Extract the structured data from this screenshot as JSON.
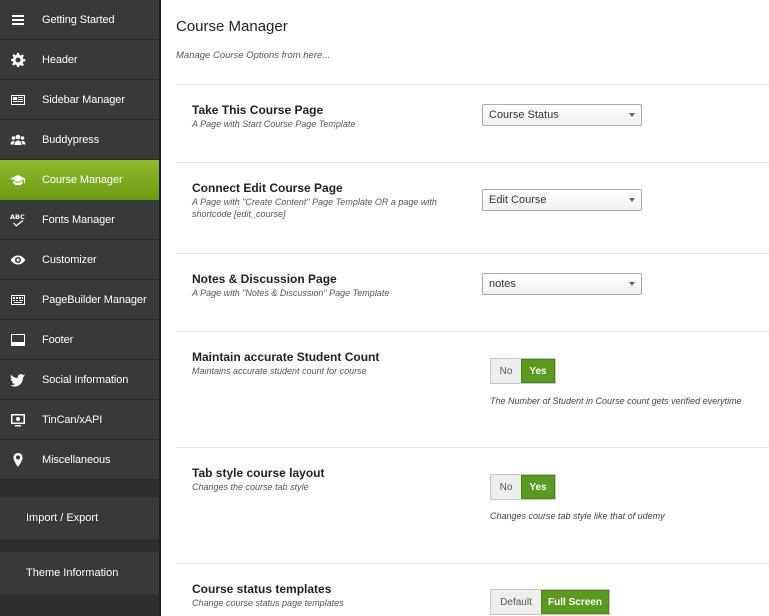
{
  "sidebar": {
    "items": [
      {
        "label": "Getting Started",
        "icon": "menu-icon"
      },
      {
        "label": "Header",
        "icon": "gear-icon"
      },
      {
        "label": "Sidebar Manager",
        "icon": "sidebar-icon"
      },
      {
        "label": "Buddypress",
        "icon": "users-icon"
      },
      {
        "label": "Course Manager",
        "icon": "graduation-cap-icon",
        "active": true
      },
      {
        "label": "Fonts Manager",
        "icon": "spellcheck-icon"
      },
      {
        "label": "Customizer",
        "icon": "eye-icon"
      },
      {
        "label": "PageBuilder Manager",
        "icon": "keyboard-icon"
      },
      {
        "label": "Footer",
        "icon": "footer-icon"
      },
      {
        "label": "Social Information",
        "icon": "twitter-icon"
      },
      {
        "label": "TinCan/xAPI",
        "icon": "monitor-icon"
      },
      {
        "label": "Miscellaneous",
        "icon": "map-pin-icon"
      }
    ],
    "extra": [
      {
        "label": "Import / Export"
      },
      {
        "label": "Theme Information"
      }
    ],
    "active_color": "#7fab22"
  },
  "main": {
    "title": "Course Manager",
    "subtitle": "Manage Course Options from here...",
    "options": [
      {
        "title": "Take This Course Page",
        "desc": "A Page with Start Course Page Template",
        "select_value": "Course Status"
      },
      {
        "title": "Connect Edit Course Page",
        "desc": "A Page with \"Create Content\" Page Template OR a page with shortcode [edit_course]",
        "select_value": "Edit Course"
      },
      {
        "title": "Notes & Discussion Page",
        "desc": "A Page with \"Notes & Discussion\" Page Template",
        "select_value": "notes"
      },
      {
        "title": "Maintain accurate Student Count",
        "desc": "Maintains accurate student count for course",
        "toggle": {
          "off": "No",
          "on": "Yes"
        },
        "note": "The Number of Student in Course count gets verified everytime"
      },
      {
        "title": "Tab style course layout",
        "desc": "Changes the course tab style",
        "toggle": {
          "off": "No",
          "on": "Yes"
        },
        "note": "Changes course tab style like that of udemy"
      },
      {
        "title": "Course status templates",
        "desc": "Change course status page templates",
        "toggle": {
          "off": "Default",
          "on": "Full Screen"
        }
      }
    ]
  }
}
